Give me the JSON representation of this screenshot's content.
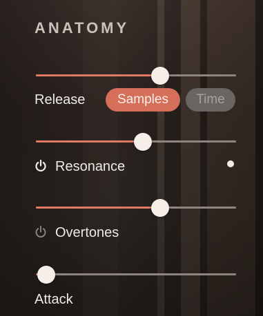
{
  "panel": {
    "title": "ANATOMY"
  },
  "release": {
    "label": "Release",
    "value": 0.62,
    "modes": [
      "Samples",
      "Time"
    ],
    "selected_mode": "Samples"
  },
  "resonance": {
    "label": "Resonance",
    "value": 0.535,
    "enabled": true
  },
  "overtones": {
    "label": "Overtones",
    "value": 0.62,
    "enabled": false
  },
  "attack": {
    "label": "Attack",
    "value": 0.05
  },
  "colors": {
    "accent": "#e07a63",
    "pill_active": "#d66f5a",
    "pill_inactive": "#6b6562",
    "track": "#8e8580",
    "thumb": "#f6eee9"
  }
}
